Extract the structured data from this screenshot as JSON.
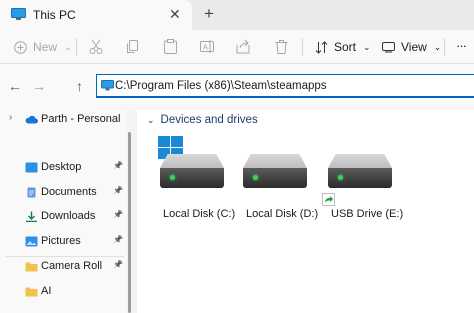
{
  "tab": {
    "title": "This PC",
    "close_glyph": "✕",
    "new_tab_glyph": "+"
  },
  "toolbar": {
    "new_label": "New",
    "sort_label": "Sort",
    "view_label": "View",
    "more_glyph": "···",
    "icons": [
      "cut-icon",
      "copy-icon",
      "paste-icon",
      "rename-icon",
      "share-icon",
      "delete-icon"
    ]
  },
  "nav": {
    "back": "←",
    "forward": "→",
    "up": "↑"
  },
  "address": {
    "path": "C:\\Program Files (x86)\\Steam\\steamapps"
  },
  "sidebar": {
    "onedrive": {
      "label": "Parth - Personal"
    },
    "items": [
      {
        "label": "Desktop",
        "icon": "desktop-icon",
        "color": "#2e8fe0"
      },
      {
        "label": "Documents",
        "icon": "documents-icon",
        "color": "#5a9bd8"
      },
      {
        "label": "Downloads",
        "icon": "downloads-icon",
        "color": "#1e7a4f"
      },
      {
        "label": "Pictures",
        "icon": "pictures-icon",
        "color": "#2d8fe6"
      },
      {
        "label": "Camera Roll",
        "icon": "folder-icon",
        "color": "#f2c14e"
      },
      {
        "label": "AI",
        "icon": "folder-icon",
        "color": "#f2c14e"
      }
    ]
  },
  "main": {
    "group_title": "Devices and drives",
    "drives": [
      {
        "label": "Local Disk (C:)",
        "has_windows_logo": true
      },
      {
        "label": "Local Disk (D:)",
        "has_windows_logo": false
      },
      {
        "label": "USB Drive (E:)",
        "has_share_badge": true
      }
    ]
  },
  "colors": {
    "accent": "#0067c0",
    "drive_led": "#3bd35a",
    "windows_blue": "#1a8ad6"
  }
}
